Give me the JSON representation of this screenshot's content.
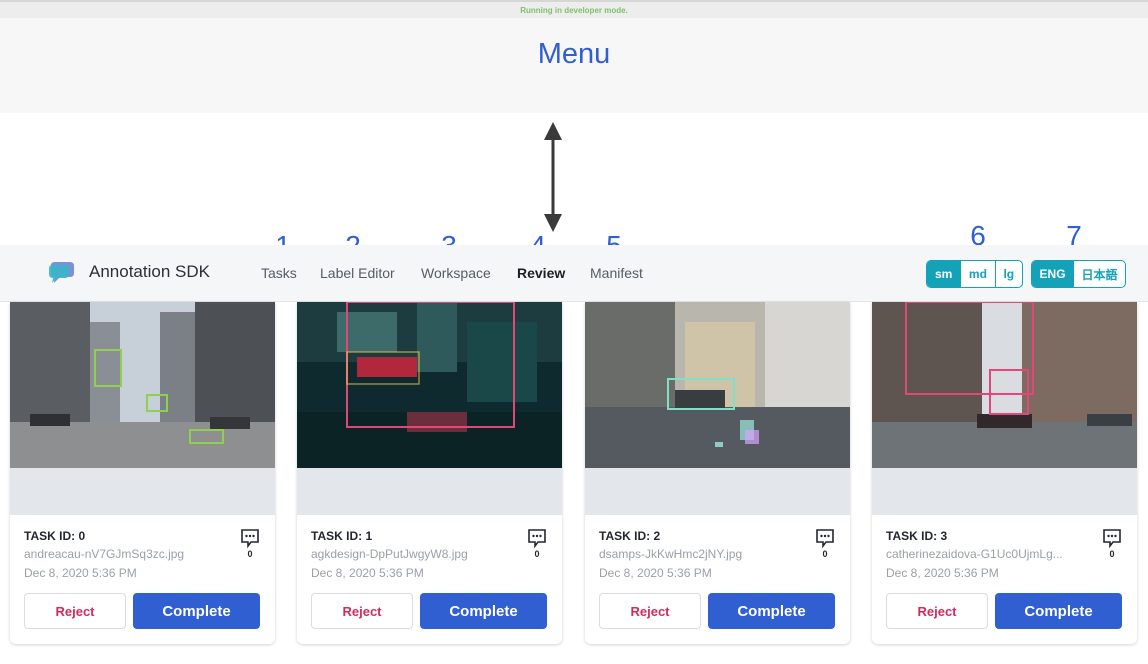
{
  "dev_banner": "Running in developer mode.",
  "menu_label": "Menu",
  "annotations": [
    "1",
    "2",
    "3",
    "4",
    "5",
    "6",
    "7"
  ],
  "header": {
    "brand": "Annotation SDK",
    "nav": [
      "Tasks",
      "Label Editor",
      "Workspace",
      "Review",
      "Manifest"
    ],
    "active_nav": "Review",
    "sizes": [
      "sm",
      "md",
      "lg"
    ],
    "selected_size": "sm",
    "languages": [
      "ENG",
      "日本語"
    ],
    "selected_language": "ENG"
  },
  "cards": [
    {
      "task_id": "TASK ID: 0",
      "filename": "andreacau-nV7GJmSq3zc.jpg",
      "date": "Dec 8, 2020 5:36 PM",
      "comments": "0",
      "reject": "Reject",
      "complete": "Complete"
    },
    {
      "task_id": "TASK ID: 1",
      "filename": "agkdesign-DpPutJwgyW8.jpg",
      "date": "Dec 8, 2020 5:36 PM",
      "comments": "0",
      "reject": "Reject",
      "complete": "Complete"
    },
    {
      "task_id": "TASK ID: 2",
      "filename": "dsamps-JkKwHmc2jNY.jpg",
      "date": "Dec 8, 2020 5:36 PM",
      "comments": "0",
      "reject": "Reject",
      "complete": "Complete"
    },
    {
      "task_id": "TASK ID: 3",
      "filename": "catherinezaidova-G1Uc0UjmLg...",
      "date": "Dec 8, 2020 5:36 PM",
      "comments": "0",
      "reject": "Reject",
      "complete": "Complete"
    }
  ],
  "colors": {
    "accent": "#2f5fd0",
    "teal": "#13a2b8",
    "reject": "#d62a5b"
  },
  "icons": {
    "logo": "chat-bubble-logo-icon",
    "comment": "comment-icon",
    "arrow": "double-arrow-icon"
  }
}
